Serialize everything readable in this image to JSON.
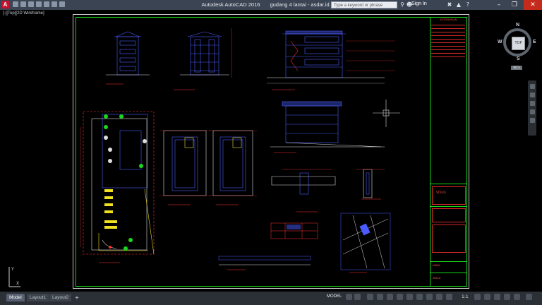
{
  "app": {
    "name": "Autodesk AutoCAD 2016",
    "document": "gudang 4 lantai - asdar.id.dwg",
    "logo_letter": "A"
  },
  "titlebar": {
    "search_placeholder": "Type a keyword or phrase",
    "sign_in": "Sign In"
  },
  "viewport": {
    "label": "[-][Top][2D Wireframe]"
  },
  "viewcube": {
    "top": "TOP",
    "north": "N",
    "south": "S",
    "east": "E",
    "west": "W",
    "wcs": "WCS"
  },
  "drawing": {
    "colors": {
      "frame": "#18d818",
      "outline": "#c8c8c8",
      "building": "#4a5cff",
      "accent": "#ff3030",
      "highlight": "#f0e020"
    },
    "titleblock": {
      "header": "KETERANGAN",
      "code": "STR-01",
      "label_a": "NAMA",
      "label_b": "SKALA"
    }
  },
  "layout_tabs": [
    {
      "label": "Model",
      "active": true
    },
    {
      "label": "Layout1",
      "active": false
    },
    {
      "label": "Layout2",
      "active": false
    }
  ],
  "statusbar": {
    "model": "MODEL",
    "scale": "1:1"
  }
}
